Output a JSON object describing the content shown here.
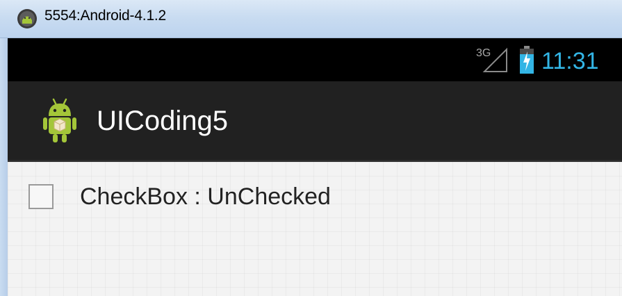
{
  "window": {
    "title": "5554:Android-4.1.2",
    "icon": "android-emulator-icon"
  },
  "status_bar": {
    "network_label": "3G",
    "signal_icon": "signal-icon",
    "battery_icon": "battery-charging-icon",
    "time": "11:31",
    "time_color": "#33b5e5"
  },
  "action_bar": {
    "app_icon": "android-robot-icon",
    "title": "UICoding5"
  },
  "content": {
    "checkbox": {
      "label": "CheckBox : UnChecked",
      "checked": false
    }
  }
}
